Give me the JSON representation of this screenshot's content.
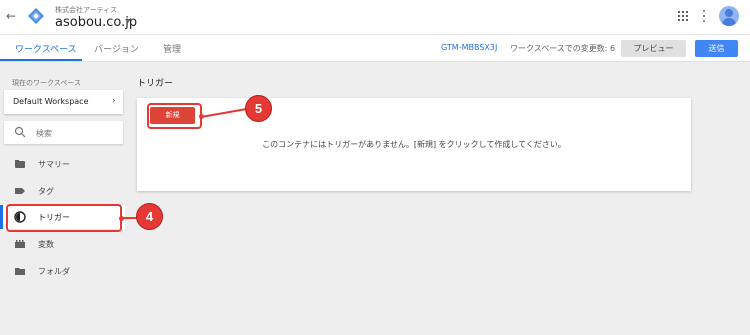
{
  "header": {
    "company": "株式会社アーティス",
    "account": "asobou.co.jp"
  },
  "tabs": [
    {
      "label": "ワークスペース",
      "active": true
    },
    {
      "label": "バージョン",
      "active": false
    },
    {
      "label": "管理",
      "active": false
    }
  ],
  "toolbar": {
    "container_id": "GTM-MBBSX3J",
    "changes_label": "ワークスペースでの変更数: 6",
    "preview_label": "プレビュー",
    "submit_label": "送信"
  },
  "sidebar": {
    "workspace_label": "現在のワークスペース",
    "workspace_name": "Default Workspace",
    "search_placeholder": "検索",
    "items": [
      {
        "label": "サマリー",
        "icon": "summary-icon"
      },
      {
        "label": "タグ",
        "icon": "tag-icon"
      },
      {
        "label": "トリガー",
        "icon": "trigger-icon",
        "active": true
      },
      {
        "label": "変数",
        "icon": "variables-icon"
      },
      {
        "label": "フォルダ",
        "icon": "folder-icon"
      }
    ]
  },
  "main": {
    "title": "トリガー",
    "new_button": "新規",
    "empty_message": "このコンテナにはトリガーがありません。[新規] をクリックして作成してください。"
  },
  "annotations": [
    {
      "number": "4"
    },
    {
      "number": "5"
    }
  ],
  "colors": {
    "accent": "#1a73e8",
    "submit": "#4285f4",
    "new_button": "#db4437",
    "annotation": "#e53935"
  }
}
